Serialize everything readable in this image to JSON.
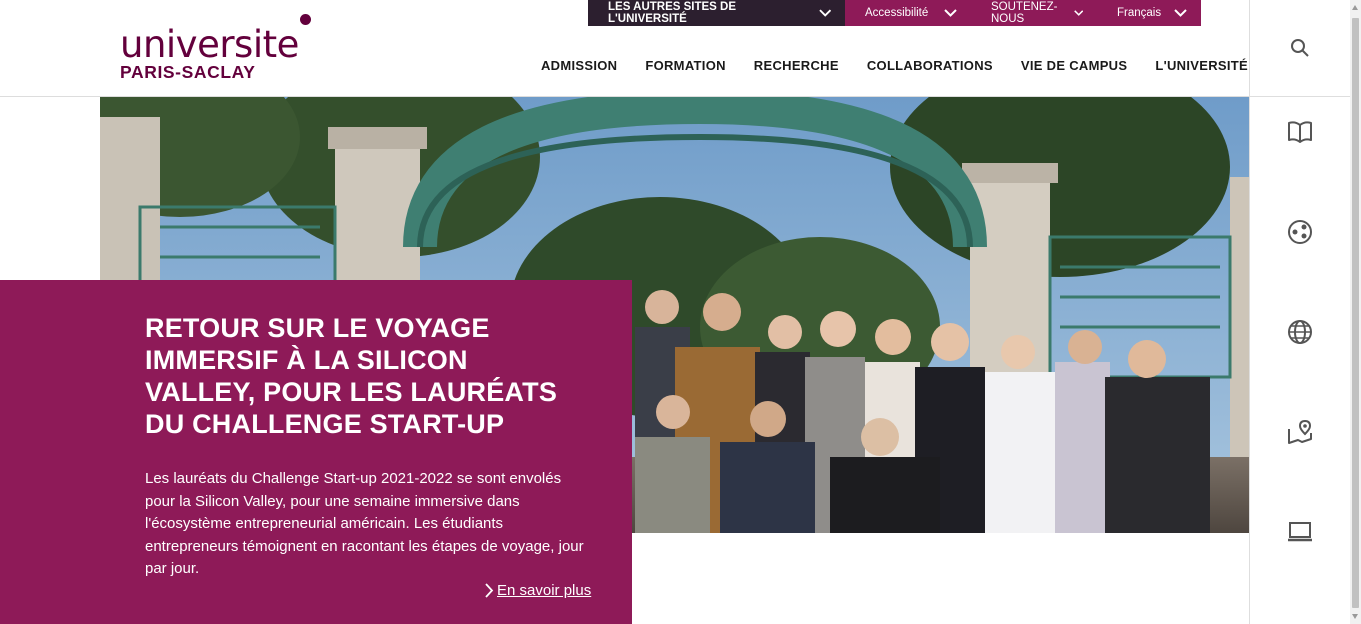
{
  "topbar": {
    "sites_label": "LES AUTRES SITES DE L'UNIVERSITÉ",
    "accessibility_label": "Accessibilité",
    "support_label": "SOUTENEZ-NOUS",
    "language_label": "Français"
  },
  "logo": {
    "line1": "universite",
    "line2": "PARIS-SACLAY",
    "color": "#63003c"
  },
  "nav": {
    "items": [
      {
        "label": "ADMISSION"
      },
      {
        "label": "FORMATION"
      },
      {
        "label": "RECHERCHE"
      },
      {
        "label": "COLLABORATIONS"
      },
      {
        "label": "VIE DE CAMPUS"
      },
      {
        "label": "L'UNIVERSITÉ"
      }
    ]
  },
  "sidebar": {
    "icons": [
      "search-icon",
      "book-icon",
      "research-icon",
      "globe-icon",
      "map-pin-icon",
      "laptop-icon"
    ]
  },
  "hero": {
    "title": "RETOUR SUR LE VOYAGE IMMERSIF À LA SILICON VALLEY, POUR LES LAURÉATS DU CHALLENGE START-UP",
    "text": "Les lauréats du Challenge Start-up 2021-2022 se sont envolés pour la Silicon Valley, pour une semaine immersive dans l'écosystème entrepreneurial américain. Les étudiants entrepreneurs témoignent en racontant les étapes de voyage, jour par jour.",
    "link_label": "En savoir plus"
  },
  "colors": {
    "brand_purple": "#8e1a58",
    "dark_bar": "#2c1f2f",
    "logo_color": "#63003c"
  }
}
